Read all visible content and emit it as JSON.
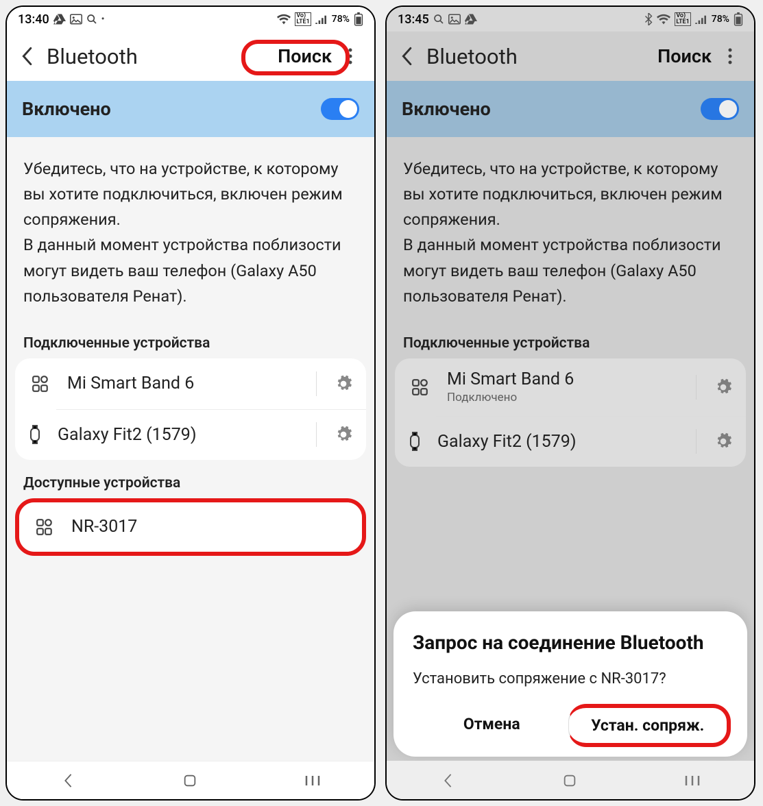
{
  "screen1": {
    "status": {
      "time": "13:40",
      "battery": "78%"
    },
    "header": {
      "title": "Bluetooth",
      "search": "Поиск"
    },
    "toggle_label": "Включено",
    "info_text": "Убедитесь, что на устройстве, к которому вы хотите подключиться, включен режим сопряжения.\nВ данный момент устройства поблизости могут видеть ваш телефон (Galaxy A50 пользователя Ренат).",
    "section_connected": "Подключенные устройства",
    "connected": [
      {
        "name": "Mi Smart Band 6"
      },
      {
        "name": "Galaxy Fit2 (1579)"
      }
    ],
    "section_available": "Доступные устройства",
    "available": [
      {
        "name": "NR-3017"
      }
    ]
  },
  "screen2": {
    "status": {
      "time": "13:45",
      "battery": "78%"
    },
    "header": {
      "title": "Bluetooth",
      "search": "Поиск"
    },
    "toggle_label": "Включено",
    "info_text": "Убедитесь, что на устройстве, к которому вы хотите подключиться, включен режим сопряжения.\nВ данный момент устройства поблизости могут видеть ваш телефон (Galaxy A50 пользователя Ренат).",
    "section_connected": "Подключенные устройства",
    "connected": [
      {
        "name": "Mi Smart Band 6",
        "sub": "Подключено"
      },
      {
        "name": "Galaxy Fit2 (1579)"
      }
    ],
    "dialog": {
      "title": "Запрос на соединение Bluetooth",
      "body": "Установить сопряжение с NR-3017?",
      "cancel": "Отмена",
      "pair": "Устан. сопряж."
    }
  }
}
